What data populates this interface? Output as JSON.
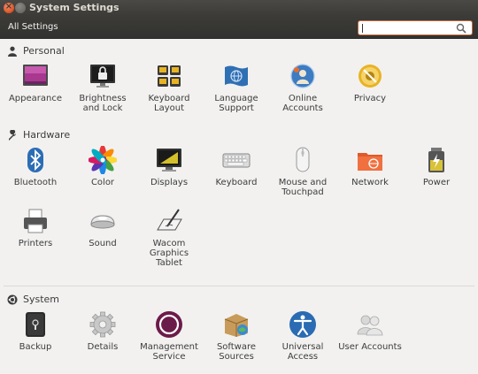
{
  "window": {
    "title": "System Settings"
  },
  "toolbar": {
    "all_settings_label": "All Settings",
    "search_value": ""
  },
  "sections": {
    "personal": {
      "title": "Personal",
      "items": [
        {
          "label": "Appearance",
          "icon": "appearance-icon"
        },
        {
          "label": "Brightness\nand Lock",
          "icon": "brightness-lock-icon"
        },
        {
          "label": "Keyboard\nLayout",
          "icon": "keyboard-layout-icon"
        },
        {
          "label": "Language\nSupport",
          "icon": "language-support-icon"
        },
        {
          "label": "Online\nAccounts",
          "icon": "online-accounts-icon"
        },
        {
          "label": "Privacy",
          "icon": "privacy-icon"
        }
      ]
    },
    "hardware": {
      "title": "Hardware",
      "items": [
        {
          "label": "Bluetooth",
          "icon": "bluetooth-icon"
        },
        {
          "label": "Color",
          "icon": "color-icon"
        },
        {
          "label": "Displays",
          "icon": "displays-icon"
        },
        {
          "label": "Keyboard",
          "icon": "keyboard-icon"
        },
        {
          "label": "Mouse and\nTouchpad",
          "icon": "mouse-icon"
        },
        {
          "label": "Network",
          "icon": "network-icon"
        },
        {
          "label": "Power",
          "icon": "power-icon"
        },
        {
          "label": "Printers",
          "icon": "printer-icon"
        },
        {
          "label": "Sound",
          "icon": "sound-icon"
        },
        {
          "label": "Wacom\nGraphics\nTablet",
          "icon": "wacom-tablet-icon"
        }
      ]
    },
    "system": {
      "title": "System",
      "items": [
        {
          "label": "Backup",
          "icon": "backup-icon"
        },
        {
          "label": "Details",
          "icon": "details-icon"
        },
        {
          "label": "Management\nService",
          "icon": "management-service-icon"
        },
        {
          "label": "Software\nSources",
          "icon": "software-sources-icon"
        },
        {
          "label": "Universal\nAccess",
          "icon": "universal-access-icon"
        },
        {
          "label": "User Accounts",
          "icon": "user-accounts-icon"
        }
      ]
    }
  },
  "colors": {
    "accent": "#e05a2b",
    "window_bg": "#f2f1f0",
    "titlebar": "#3c3b37"
  }
}
